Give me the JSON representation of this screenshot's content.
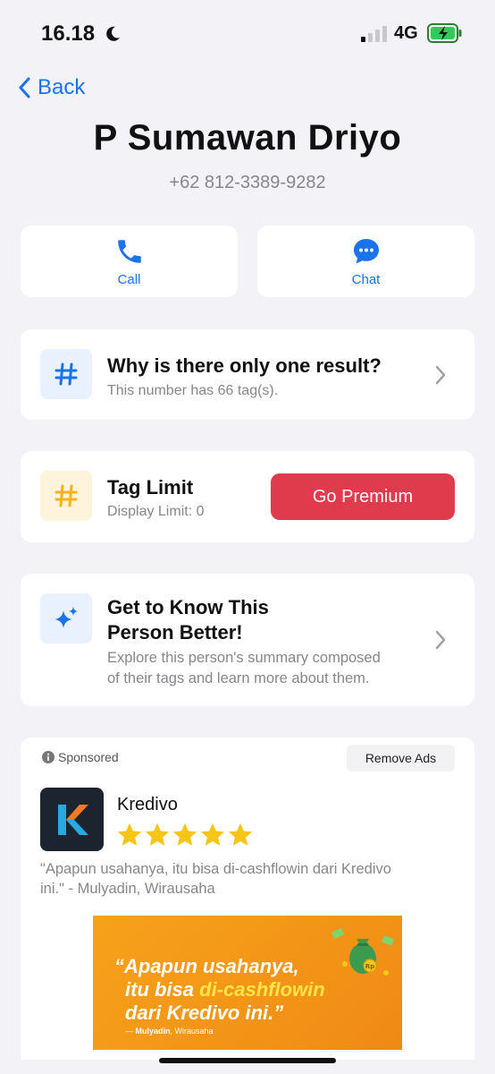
{
  "status": {
    "time": "16.18",
    "network": "4G"
  },
  "nav": {
    "back_label": "Back"
  },
  "contact": {
    "name": "P Sumawan Driyo",
    "phone": "+62 812-3389-9282"
  },
  "actions": {
    "call_label": "Call",
    "chat_label": "Chat"
  },
  "why_card": {
    "title": "Why is there only one result?",
    "subtitle": "This number has 66 tag(s)."
  },
  "tag_limit": {
    "title": "Tag Limit",
    "subtitle": "Display Limit: 0",
    "button_label": "Go Premium"
  },
  "know_card": {
    "title_line1": "Get to Know This",
    "title_line2": "Person Better!",
    "desc_line1": "Explore this person's summary composed",
    "desc_line2": "of their tags and learn more about them."
  },
  "ad": {
    "sponsored_label": "Sponsored",
    "remove_ads_label": "Remove Ads",
    "app_name": "Kredivo",
    "rating": 5,
    "quote_line1": "\"Apapun usahanya, itu bisa di-cashflowin dari Kredivo",
    "quote_line2": "ini.\" - Mulyadin, Wirausaha",
    "banner_line1": "“Apapun usahanya,",
    "banner_line2_pre": "itu bisa ",
    "banner_line2_hl": "di-cashflowin",
    "banner_line3": "dari Kredivo ini.”",
    "banner_credit_prefix": "— ",
    "banner_credit_name": "Mulyadin",
    "banner_credit_role": ", Wirausaha"
  },
  "colors": {
    "accent": "#1a73e8",
    "premium": "#e03a4d",
    "star": "#f5c518",
    "background": "#f2f2f7"
  }
}
